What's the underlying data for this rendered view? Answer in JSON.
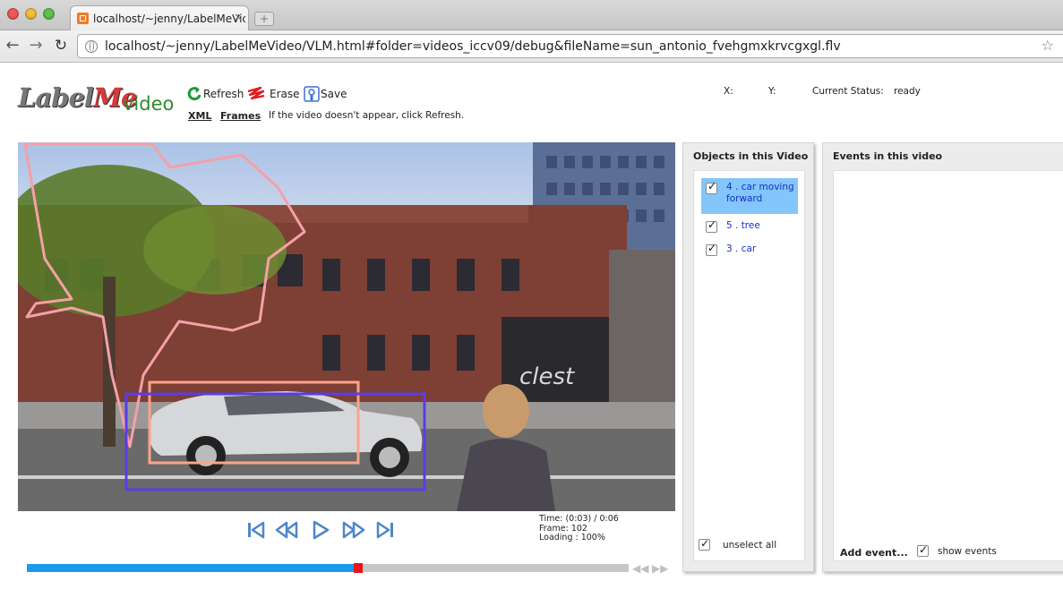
{
  "browser": {
    "tab_title": "localhost/~jenny/LabelMeVic",
    "tab_close": "×",
    "newtab_label": "+",
    "url": "localhost/~jenny/LabelMeVideo/VLM.html#folder=videos_iccv09/debug&fileName=sun_antonio_fvehgmxkrvcgxgl.flv",
    "icons": [
      "back-arrow-icon",
      "forward-arrow-icon",
      "reload-icon",
      "globe-icon",
      "bookmark-star-icon"
    ]
  },
  "logo": {
    "part1": "Label",
    "part2": "Me",
    "part3": "video"
  },
  "toolbar": {
    "refresh_label": "Refresh",
    "erase_label": "Erase",
    "save_label": "Save",
    "xml_link": "XML",
    "frames_link": "Frames",
    "hint": "If the video doesn't appear, click Refresh."
  },
  "status": {
    "x_label": "X:",
    "y_label": "Y:",
    "status_label": "Current Status:",
    "status_value": "ready"
  },
  "player": {
    "time": "Time: (0:03) / 0:06",
    "frame": "Frame: 102",
    "loading": "Loading : 100%",
    "progress_percent": 55,
    "accent_color": "#1b9af0",
    "knob_color": "#e8151a"
  },
  "annotations": [
    {
      "id": 5,
      "label": "tree",
      "color": "#f5a0a8"
    },
    {
      "id": 3,
      "label": "car",
      "color": "#fba48a"
    },
    {
      "id": 4,
      "label": "car moving forward",
      "color": "#5a3de8"
    }
  ],
  "objects_panel": {
    "title": "Objects in this Video",
    "items": [
      {
        "text": "4 . car moving forward",
        "selected": true
      },
      {
        "text": "5 . tree",
        "selected": false
      },
      {
        "text": "3 . car",
        "selected": false
      }
    ],
    "unselect_label": "unselect all"
  },
  "events_panel": {
    "title": "Events in this video",
    "add_label": "Add event...",
    "show_label": "show events"
  }
}
